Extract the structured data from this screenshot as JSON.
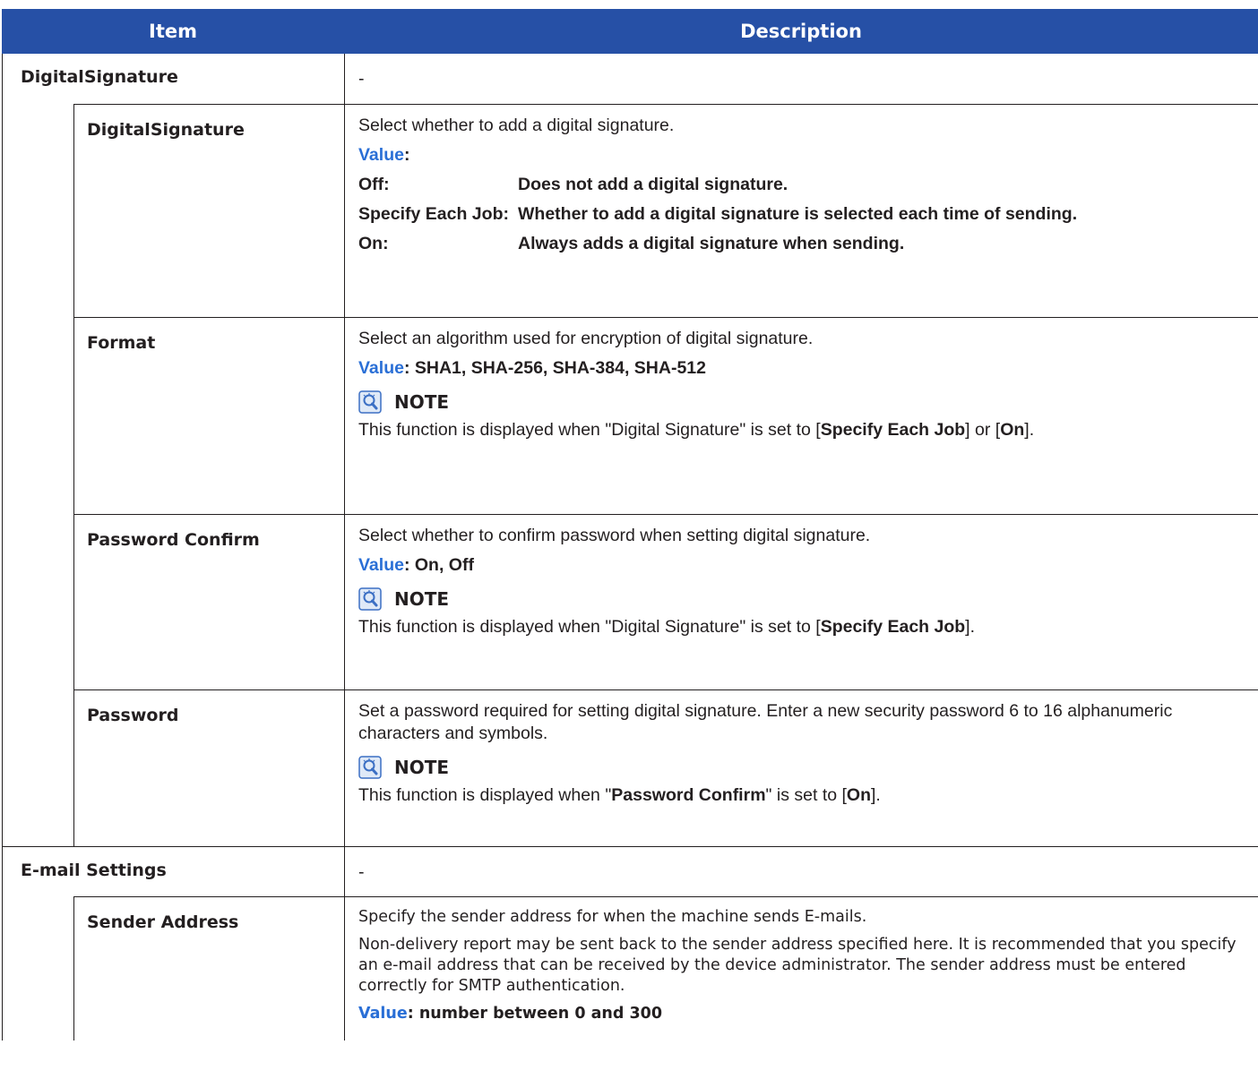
{
  "header": {
    "item": "Item",
    "description": "Description"
  },
  "rows": {
    "digital_signature_group": {
      "item": "DigitalSignature",
      "desc": "-"
    },
    "digital_signature": {
      "item": "DigitalSignature",
      "desc": "Select whether to add a digital signature.",
      "value_label": "Value",
      "colon": ":",
      "options": [
        {
          "key": "Off:",
          "text": "Does not add a digital signature."
        },
        {
          "key": "Specify Each Job:",
          "text": "Whether to add a digital signature is selected each time of sending."
        },
        {
          "key": "On:",
          "text": "Always adds a digital signature when sending."
        }
      ]
    },
    "format": {
      "item": "Format",
      "desc": "Select an algorithm used for encryption of digital signature.",
      "value_label": "Value",
      "value_text": ": SHA1, SHA-256, SHA-384, SHA-512",
      "note_label": "NOTE",
      "note_pre": "This function is displayed when \"Digital Signature\" is set to [",
      "note_b1": "Specify Each Job",
      "note_mid": "] or [",
      "note_b2": "On",
      "note_post": "]."
    },
    "password_confirm": {
      "item": "Password Confirm",
      "desc": "Select whether to confirm password when setting digital signature.",
      "value_label": "Value",
      "value_text": ": On, Off",
      "note_label": "NOTE",
      "note_pre": "This function is displayed when \"Digital Signature\" is set to [",
      "note_b1": "Specify Each Job",
      "note_post": "]."
    },
    "password": {
      "item": "Password",
      "desc": "Set a password required for setting digital signature. Enter a new security password 6 to 16 alphanumeric characters and symbols.",
      "note_label": "NOTE",
      "note_pre": "This function is displayed when \"",
      "note_b1": "Password Confirm",
      "note_mid": "\" is set to [",
      "note_b2": "On",
      "note_post": "]."
    },
    "email_settings": {
      "item": "E-mail Settings",
      "desc": "-"
    },
    "sender_address": {
      "item": "Sender Address",
      "desc1": "Specify the sender address for when the machine sends E-mails.",
      "desc2": "Non-delivery report may be sent back to the sender address specified here. It is recommended that you specify an e-mail address that can be received by the device administrator. The sender address must be entered correctly for SMTP authentication.",
      "value_label": "Value",
      "value_text": ": number between 0 and 300"
    }
  },
  "colors": {
    "header_bg": "#2650a6",
    "value_blue": "#2a6fd6",
    "icon_blue": "#3b6fc4"
  }
}
